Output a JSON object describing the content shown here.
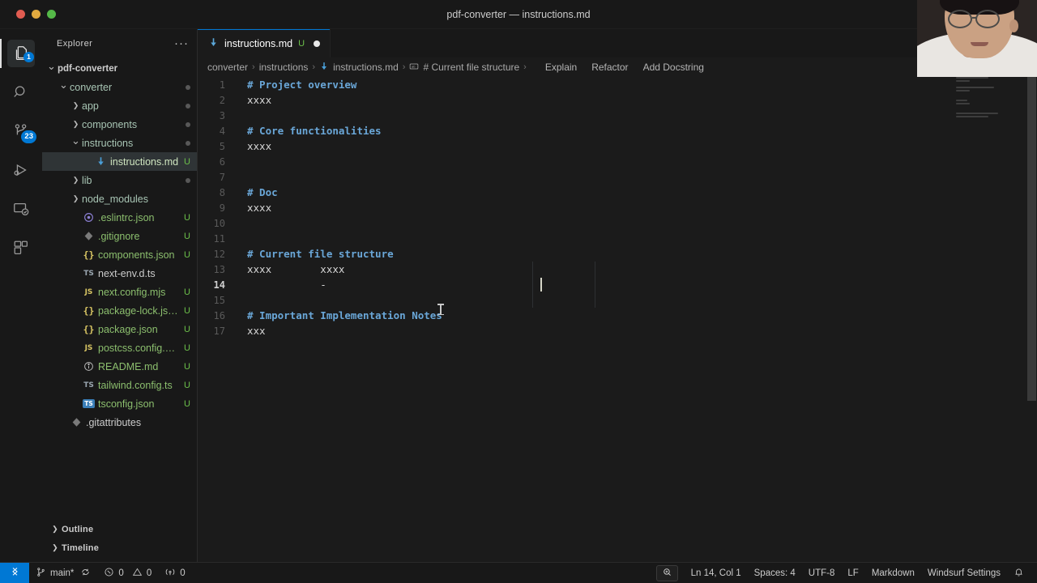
{
  "window": {
    "title": "pdf-converter — instructions.md",
    "traffic_lights": [
      "close",
      "minimize",
      "zoom"
    ],
    "layout_icons": [
      "toggle-primary-sidebar",
      "toggle-panel",
      "toggle-secondary-sidebar",
      "customize-layout"
    ]
  },
  "activitybar": {
    "items": [
      {
        "name": "explorer",
        "icon": "files-icon",
        "badge": "1",
        "active": true
      },
      {
        "name": "search",
        "icon": "search-icon",
        "badge": "",
        "active": false
      },
      {
        "name": "source-control",
        "icon": "source-control-icon",
        "badge": "23",
        "active": false
      },
      {
        "name": "run-and-debug",
        "icon": "run-debug-icon",
        "badge": "",
        "active": false
      },
      {
        "name": "remote-explorer",
        "icon": "remote-explorer-icon",
        "badge": "",
        "active": false
      },
      {
        "name": "extensions",
        "icon": "extensions-icon",
        "badge": "",
        "active": false
      }
    ]
  },
  "sidebar": {
    "title": "Explorer",
    "more_actions": "···",
    "tree": [
      {
        "label": "pdf-converter",
        "type": "root",
        "indent": 0,
        "expanded": true,
        "icon": "",
        "badge": "",
        "selected": false
      },
      {
        "label": "converter",
        "type": "folder",
        "indent": 1,
        "expanded": true,
        "icon": "",
        "badge": "dot",
        "selected": false
      },
      {
        "label": "app",
        "type": "folder",
        "indent": 2,
        "expanded": false,
        "icon": "",
        "badge": "dot",
        "selected": false
      },
      {
        "label": "components",
        "type": "folder",
        "indent": 2,
        "expanded": false,
        "icon": "",
        "badge": "dot",
        "selected": false
      },
      {
        "label": "instructions",
        "type": "folder",
        "indent": 2,
        "expanded": true,
        "icon": "",
        "badge": "dot",
        "selected": false
      },
      {
        "label": "instructions.md",
        "type": "file",
        "indent": 3,
        "expanded": null,
        "icon": "markdown",
        "badge": "U",
        "selected": true
      },
      {
        "label": "lib",
        "type": "folder",
        "indent": 2,
        "expanded": false,
        "icon": "",
        "badge": "dot",
        "selected": false
      },
      {
        "label": "node_modules",
        "type": "folder",
        "indent": 2,
        "expanded": false,
        "icon": "",
        "badge": "",
        "selected": false
      },
      {
        "label": ".eslintrc.json",
        "type": "file",
        "indent": 2,
        "expanded": null,
        "icon": "eslint",
        "badge": "U",
        "selected": false
      },
      {
        "label": ".gitignore",
        "type": "file",
        "indent": 2,
        "expanded": null,
        "icon": "git",
        "badge": "U",
        "selected": false
      },
      {
        "label": "components.json",
        "type": "file",
        "indent": 2,
        "expanded": null,
        "icon": "json",
        "badge": "U",
        "selected": false
      },
      {
        "label": "next-env.d.ts",
        "type": "file",
        "indent": 2,
        "expanded": null,
        "icon": "ts",
        "badge": "",
        "selected": false
      },
      {
        "label": "next.config.mjs",
        "type": "file",
        "indent": 2,
        "expanded": null,
        "icon": "js",
        "badge": "U",
        "selected": false
      },
      {
        "label": "package-lock.js…",
        "type": "file",
        "indent": 2,
        "expanded": null,
        "icon": "json",
        "badge": "U",
        "selected": false
      },
      {
        "label": "package.json",
        "type": "file",
        "indent": 2,
        "expanded": null,
        "icon": "json",
        "badge": "U",
        "selected": false
      },
      {
        "label": "postcss.config.…",
        "type": "file",
        "indent": 2,
        "expanded": null,
        "icon": "js",
        "badge": "U",
        "selected": false
      },
      {
        "label": "README.md",
        "type": "file",
        "indent": 2,
        "expanded": null,
        "icon": "info",
        "badge": "U",
        "selected": false
      },
      {
        "label": "tailwind.config.ts",
        "type": "file",
        "indent": 2,
        "expanded": null,
        "icon": "ts",
        "badge": "U",
        "selected": false
      },
      {
        "label": "tsconfig.json",
        "type": "file",
        "indent": 2,
        "expanded": null,
        "icon": "tsconfig",
        "badge": "U",
        "selected": false
      },
      {
        "label": ".gitattributes",
        "type": "file",
        "indent": 1,
        "expanded": null,
        "icon": "git",
        "badge": "",
        "selected": false
      }
    ],
    "sections": [
      {
        "label": "Outline",
        "expanded": false
      },
      {
        "label": "Timeline",
        "expanded": false
      }
    ]
  },
  "editor": {
    "tab": {
      "label": "instructions.md",
      "badge": "U",
      "dirty": true,
      "icon": "markdown-icon"
    },
    "tab_actions": [
      "compare-changes-icon",
      "open-preview-icon",
      "split-editor-icon"
    ],
    "breadcrumbs": [
      "converter",
      "instructions",
      "instructions.md",
      "# Current file structure"
    ],
    "breadcrumb_separator": "›",
    "codelens": [
      "Explain",
      "Refactor",
      "Add Docstring"
    ],
    "lines": [
      {
        "n": "1",
        "text": "# Project overview",
        "kind": "heading"
      },
      {
        "n": "2",
        "text": "xxxx",
        "kind": "plain"
      },
      {
        "n": "3",
        "text": "",
        "kind": "plain"
      },
      {
        "n": "4",
        "text": "# Core functionalities",
        "kind": "heading"
      },
      {
        "n": "5",
        "text": "xxxx",
        "kind": "plain"
      },
      {
        "n": "6",
        "text": "",
        "kind": "plain"
      },
      {
        "n": "7",
        "text": "",
        "kind": "plain"
      },
      {
        "n": "8",
        "text": "# Doc",
        "kind": "heading"
      },
      {
        "n": "9",
        "text": "xxxx",
        "kind": "plain"
      },
      {
        "n": "10",
        "text": "",
        "kind": "plain"
      },
      {
        "n": "11",
        "text": "",
        "kind": "plain"
      },
      {
        "n": "12",
        "text": "# Current file structure",
        "kind": "heading"
      },
      {
        "n": "13",
        "text": "xxxx        xxxx",
        "kind": "plain"
      },
      {
        "n": "14",
        "text": "            -",
        "kind": "plain"
      },
      {
        "n": "15",
        "text": "",
        "kind": "plain"
      },
      {
        "n": "16",
        "text": "# Important Implementation Notes",
        "kind": "heading"
      },
      {
        "n": "17",
        "text": "xxx",
        "kind": "plain"
      }
    ],
    "active_line": "14"
  },
  "statusbar": {
    "remote_icon": "remote-window-icon",
    "branch": "main*",
    "sync_icon": "sync-icon",
    "errors": "0",
    "warnings": "0",
    "ports": "0",
    "zoom_icon": "search-magnifier-icon",
    "cursor_position": "Ln 14, Col 1",
    "indentation": "Spaces: 4",
    "encoding": "UTF-8",
    "eol": "LF",
    "language": "Markdown",
    "windsurf_settings": "Windsurf Settings",
    "bell_icon": "notifications-bell-icon"
  },
  "colors": {
    "accent": "#0078d4",
    "modified_green": "#6cc04a",
    "heading_blue": "#6aa7d8",
    "editor_bg": "#1b1b1b",
    "chrome_bg": "#181818"
  }
}
